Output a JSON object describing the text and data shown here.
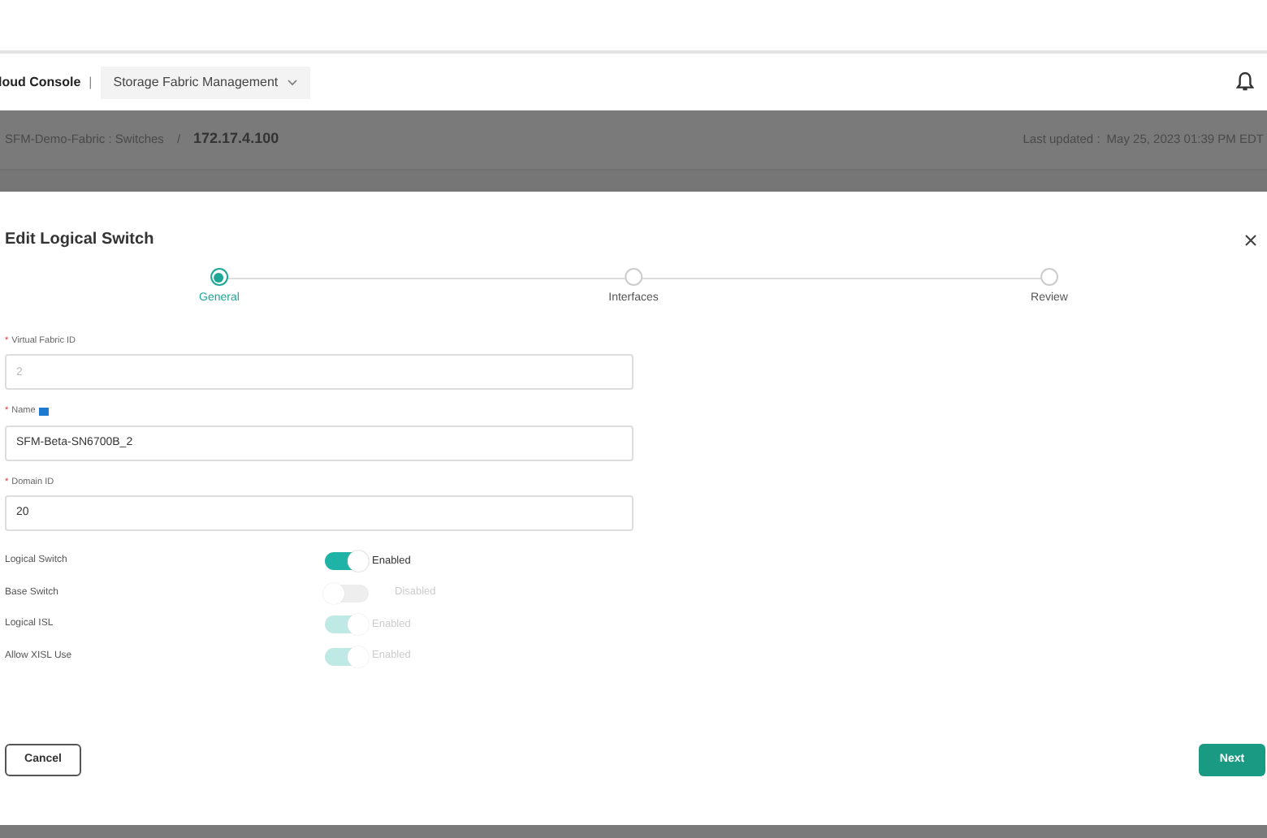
{
  "header": {
    "brand": "loud Console",
    "separator": "|",
    "app_menu": "Storage Fabric Management"
  },
  "breadcrumb": {
    "parent": "SFM-Demo-Fabric : Switches",
    "separator": "/",
    "current": "172.17.4.100",
    "last_updated_label": "Last updated :",
    "last_updated": "May 25, 2023 01:39 PM EDT"
  },
  "dialog": {
    "title": "Edit Logical Switch",
    "steps": [
      {
        "label": "General",
        "selected": true
      },
      {
        "label": "Interfaces",
        "selected": false
      },
      {
        "label": "Review",
        "selected": false
      }
    ],
    "fields": [
      {
        "label": "Virtual Fabric ID",
        "required_mark": "*",
        "info": false,
        "value": "2",
        "disabled": true
      },
      {
        "label": "Name",
        "required_mark": "*",
        "info": true,
        "value": "SFM-Beta-SN6700B_2",
        "disabled": false
      },
      {
        "label": "Domain ID",
        "required_mark": "*",
        "info": false,
        "value": "20",
        "disabled": false
      }
    ],
    "toggles": [
      {
        "label": "Logical Switch",
        "on": true,
        "disabled": false,
        "state_text": "Enabled"
      },
      {
        "label": "Base Switch",
        "on": false,
        "disabled": true,
        "state_text": "Disabled"
      },
      {
        "label": "Logical ISL",
        "on": true,
        "disabled": true,
        "state_text": "Enabled"
      },
      {
        "label": "Allow XISL Use",
        "on": true,
        "disabled": true,
        "state_text": "Enabled"
      }
    ],
    "buttons": [
      {
        "label": "Cancel",
        "kind": "secondary"
      },
      {
        "label": "Next",
        "kind": "primary"
      }
    ]
  }
}
